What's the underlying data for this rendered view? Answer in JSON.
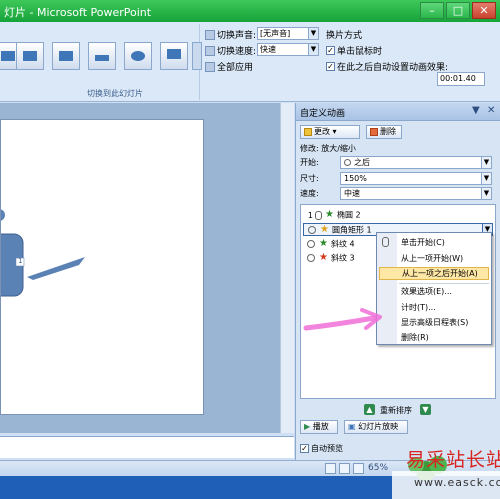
{
  "window": {
    "title": "灯片 - Microsoft PowerPoint",
    "minimize": "–",
    "maximize": "□",
    "close": "✕"
  },
  "ribbon": {
    "transitions_caption": "切换到此幻灯片",
    "sound_label": "切换声音:",
    "sound_value": "[无声音]",
    "speed_label": "切换速度:",
    "speed_value": "快速",
    "apply_all_label": "全部应用",
    "advance_title": "换片方式",
    "on_click_label": "单击鼠标时",
    "on_click_checked": true,
    "after_label": "在此之后自动设置动画效果:",
    "after_checked": true,
    "after_value": "00:01.40"
  },
  "slide": {
    "shape_label": "1"
  },
  "taskpane": {
    "title": "自定义动画",
    "change_button": "更改",
    "delete_button": "删除",
    "modify_label": "修改: 放大/缩小",
    "start_label": "开始:",
    "start_value": "之后",
    "size_label": "尺寸:",
    "size_value": "150%",
    "speed_label": "速度:",
    "speed_value": "中速",
    "items": [
      {
        "num": "1",
        "name": "椭圆 2",
        "star": "green"
      },
      {
        "num": "",
        "name": "圆角矩形 1",
        "star": "yellow"
      },
      {
        "num": "",
        "name": "斜纹 4",
        "star": "green"
      },
      {
        "num": "",
        "name": "斜纹 3",
        "star": "red"
      }
    ],
    "reorder_label": "重新排序",
    "play_button": "播放",
    "slideshow_button": "幻灯片放映",
    "autopreview_label": "自动预览",
    "autopreview_checked": true
  },
  "context_menu": {
    "items": [
      {
        "label": "单击开始(C)"
      },
      {
        "label": "从上一项开始(W)"
      },
      {
        "label": "从上一项之后开始(A)"
      },
      {
        "label": "效果选项(E)..."
      },
      {
        "label": "计时(T)..."
      },
      {
        "label": "显示高级日程表(S)"
      },
      {
        "label": "删除(R)"
      }
    ]
  },
  "statusbar": {
    "zoom": "65%"
  },
  "watermark": {
    "title": "易采站长站",
    "url": "www.easck.com"
  },
  "colors": {
    "titlebar": "#16a33a",
    "ribbon": "#dbe8f7",
    "shape_fill": "#5b82b5",
    "menu_highlight": "#ffe8a6",
    "arrow_pink": "#f06fd8"
  }
}
